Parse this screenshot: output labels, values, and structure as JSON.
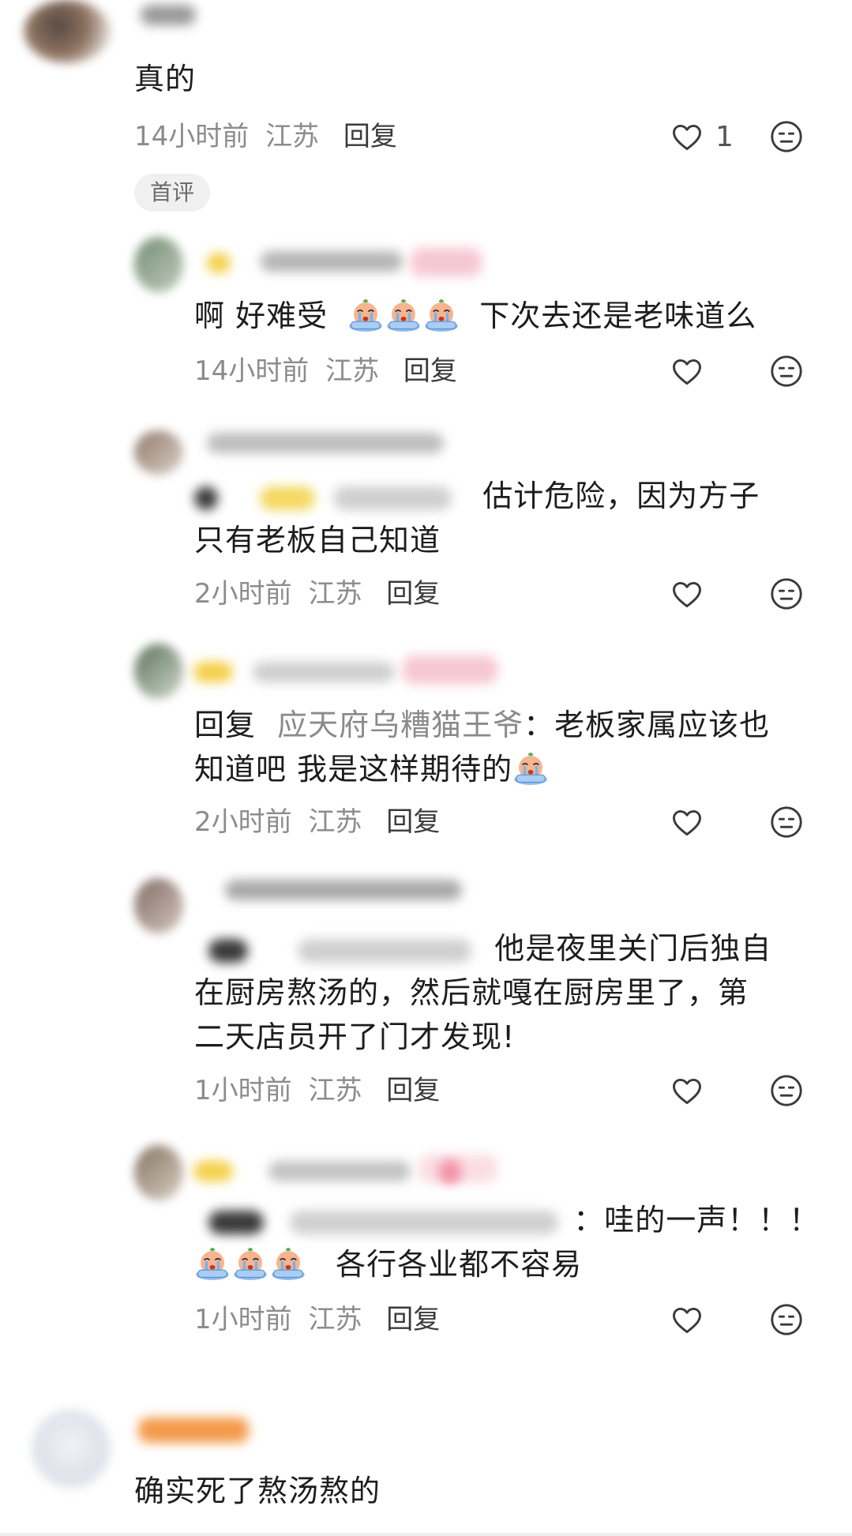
{
  "comments": [
    {
      "id": "c1",
      "text": "真的",
      "time": "14小时前",
      "location": "江苏",
      "reply_label": "回复",
      "like_count": "1",
      "tag": "首评"
    },
    {
      "id": "c2",
      "text_a": "啊 好难受",
      "text_b": "下次去还是老味道么",
      "time": "14小时前",
      "location": "江苏",
      "reply_label": "回复"
    },
    {
      "id": "c3",
      "text_a": "估计危险，因为方子",
      "text_b": "只有老板自己知道",
      "time": "2小时前",
      "location": "江苏",
      "reply_label": "回复"
    },
    {
      "id": "c4",
      "reply_prefix": "回复",
      "mention": "应天府乌糟猫王爷",
      "text_a": "：老板家属应该也",
      "text_b": "知道吧 我是这样期待的",
      "time": "2小时前",
      "location": "江苏",
      "reply_label": "回复"
    },
    {
      "id": "c5",
      "text_a": "他是夜里关门后独自",
      "text_b": "在厨房熬汤的，然后就嘎在厨房里了，第",
      "text_c": "二天店员开了门才发现!",
      "time": "1小时前",
      "location": "江苏",
      "reply_label": "回复"
    },
    {
      "id": "c6",
      "text_a": "：哇的一声！！！",
      "text_b": "各行各业都不容易",
      "time": "1小时前",
      "location": "江苏",
      "reply_label": "回复"
    },
    {
      "id": "c7",
      "text": "确实死了熬汤熬的"
    }
  ],
  "icons": {
    "like": "heart-outline-icon",
    "meh": "neutral-face-icon",
    "emoji": "crying-face-emoji"
  },
  "colors": {
    "text": "#1d1d1d",
    "meta": "#8c8c8c",
    "reply": "#3a3a3a",
    "mention": "#8a8a8a",
    "tag_bg": "#f0f0f0"
  }
}
